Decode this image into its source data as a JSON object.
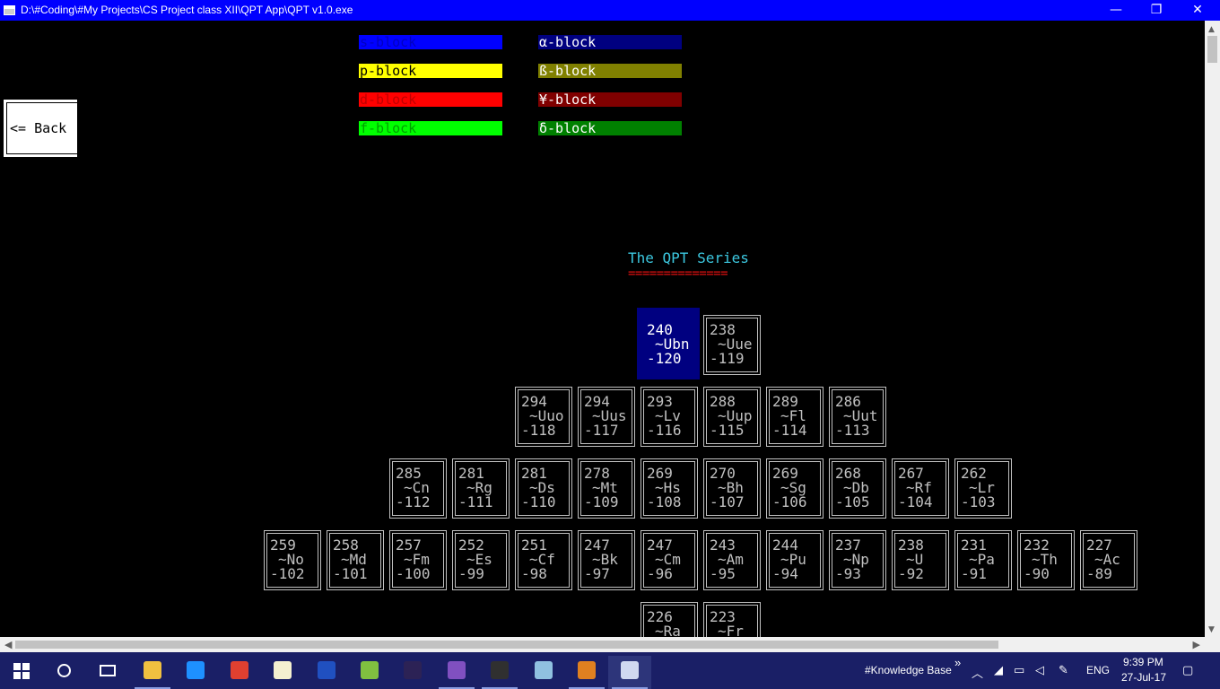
{
  "window": {
    "title": "D:\\#Coding\\#My Projects\\CS Project class XII\\QPT App\\QPT v1.0.exe",
    "minimize_glyph": "—",
    "maximize_glyph": "❐",
    "close_glyph": "✕"
  },
  "legend": [
    {
      "label": "s-block",
      "bg": "#0000ff",
      "fg": "#0000c0"
    },
    {
      "label": "α-block",
      "bg": "#000080",
      "fg": "#ffffff"
    },
    {
      "label": "p-block",
      "bg": "#ffff00",
      "fg": "#000000"
    },
    {
      "label": "ß-block",
      "bg": "#808000",
      "fg": "#ffffff"
    },
    {
      "label": "d-block",
      "bg": "#ff0000",
      "fg": "#c00000"
    },
    {
      "label": "¥-block",
      "bg": "#800000",
      "fg": "#ffffff"
    },
    {
      "label": "f-block",
      "bg": "#00ff00",
      "fg": "#00a000"
    },
    {
      "label": "δ-block",
      "bg": "#008000",
      "fg": "#ffffff"
    }
  ],
  "back_button": {
    "label": "<= Back"
  },
  "series": {
    "title": "The QPT Series",
    "underline": "=============="
  },
  "elements": {
    "row1": [
      {
        "mass": "240",
        "symbol": "~Ubn",
        "number": "-120",
        "selected": true
      },
      {
        "mass": "238",
        "symbol": "~Uue",
        "number": "-119"
      }
    ],
    "row2": [
      {
        "mass": "294",
        "symbol": "~Uuo",
        "number": "-118"
      },
      {
        "mass": "294",
        "symbol": "~Uus",
        "number": "-117"
      },
      {
        "mass": "293",
        "symbol": "~Lv",
        "number": "-116"
      },
      {
        "mass": "288",
        "symbol": "~Uup",
        "number": "-115"
      },
      {
        "mass": "289",
        "symbol": "~Fl",
        "number": "-114"
      },
      {
        "mass": "286",
        "symbol": "~Uut",
        "number": "-113"
      }
    ],
    "row3": [
      {
        "mass": "285",
        "symbol": "~Cn",
        "number": "-112"
      },
      {
        "mass": "281",
        "symbol": "~Rg",
        "number": "-111"
      },
      {
        "mass": "281",
        "symbol": "~Ds",
        "number": "-110"
      },
      {
        "mass": "278",
        "symbol": "~Mt",
        "number": "-109"
      },
      {
        "mass": "269",
        "symbol": "~Hs",
        "number": "-108"
      },
      {
        "mass": "270",
        "symbol": "~Bh",
        "number": "-107"
      },
      {
        "mass": "269",
        "symbol": "~Sg",
        "number": "-106"
      },
      {
        "mass": "268",
        "symbol": "~Db",
        "number": "-105"
      },
      {
        "mass": "267",
        "symbol": "~Rf",
        "number": "-104"
      },
      {
        "mass": "262",
        "symbol": "~Lr",
        "number": "-103"
      }
    ],
    "row4": [
      {
        "mass": "259",
        "symbol": "~No",
        "number": "-102"
      },
      {
        "mass": "258",
        "symbol": "~Md",
        "number": "-101"
      },
      {
        "mass": "257",
        "symbol": "~Fm",
        "number": "-100"
      },
      {
        "mass": "252",
        "symbol": "~Es",
        "number": "-99"
      },
      {
        "mass": "251",
        "symbol": "~Cf",
        "number": "-98"
      },
      {
        "mass": "247",
        "symbol": "~Bk",
        "number": "-97"
      },
      {
        "mass": "247",
        "symbol": "~Cm",
        "number": "-96"
      },
      {
        "mass": "243",
        "symbol": "~Am",
        "number": "-95"
      },
      {
        "mass": "244",
        "symbol": "~Pu",
        "number": "-94"
      },
      {
        "mass": "237",
        "symbol": "~Np",
        "number": "-93"
      },
      {
        "mass": "238",
        "symbol": "~U",
        "number": "-92"
      },
      {
        "mass": "231",
        "symbol": "~Pa",
        "number": "-91"
      },
      {
        "mass": "232",
        "symbol": "~Th",
        "number": "-90"
      },
      {
        "mass": "227",
        "symbol": "~Ac",
        "number": "-89"
      }
    ],
    "row5": [
      {
        "mass": "226",
        "symbol": "~Ra",
        "number": ""
      },
      {
        "mass": "223",
        "symbol": "~Fr",
        "number": ""
      }
    ]
  },
  "taskbar": {
    "apps": [
      {
        "name": "file-explorer-icon",
        "color": "#f0c040",
        "open": true
      },
      {
        "name": "edge-icon",
        "color": "#1e90ff",
        "open": false
      },
      {
        "name": "chrome-icon",
        "color": "#e04030",
        "open": false
      },
      {
        "name": "xd-icon",
        "color": "#f4f0d0",
        "open": false
      },
      {
        "name": "devcpp-icon",
        "color": "#2050c0",
        "open": false
      },
      {
        "name": "android-studio-icon",
        "color": "#80c040",
        "open": false
      },
      {
        "name": "eclipse-icon",
        "color": "#2c2255",
        "open": false
      },
      {
        "name": "visual-studio-icon",
        "color": "#8050c0",
        "open": true
      },
      {
        "name": "command-prompt-icon",
        "color": "#303030",
        "open": true
      },
      {
        "name": "virtualbox-icon",
        "color": "#90c0e0",
        "open": false
      },
      {
        "name": "sublime-icon",
        "color": "#e08020",
        "open": true
      },
      {
        "name": "console-app-icon",
        "color": "#d0d8f0",
        "open": true,
        "focused": true
      }
    ],
    "knowledge_base": "#Knowledge Base",
    "chevron": "»",
    "language": "ENG",
    "time": "9:39 PM",
    "date": "27-Jul-17"
  },
  "scrollbars": {
    "up": "▲",
    "down": "▼",
    "left": "◀",
    "right": "▶"
  }
}
